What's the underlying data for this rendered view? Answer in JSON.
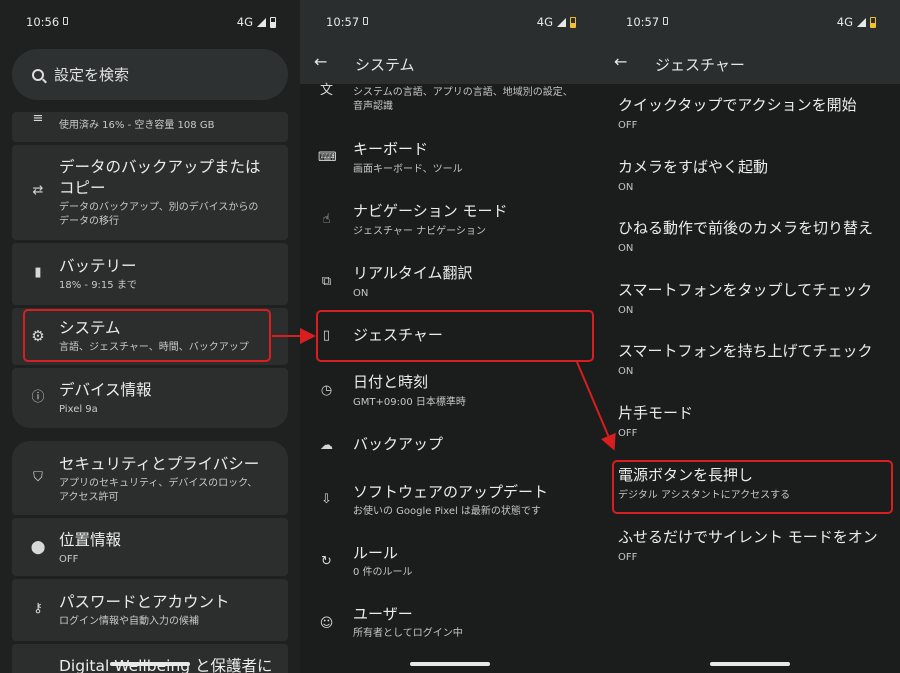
{
  "panel1": {
    "status": {
      "time": "10:56",
      "network": "4G"
    },
    "search_placeholder": "設定を検索",
    "storage_sub": "使用済み 16% - 空き容量 108 GB",
    "backup": {
      "title_l1": "データのバックアップまたは",
      "title_l2": "コピー",
      "sub_l1": "データのバックアップ、別のデバイスからの",
      "sub_l2": "データの移行"
    },
    "battery": {
      "title": "バッテリー",
      "sub": "18% - 9:15 まで"
    },
    "system": {
      "title": "システム",
      "sub": "言語、ジェスチャー、時間、バックアップ"
    },
    "device": {
      "title": "デバイス情報",
      "sub": "Pixel 9a"
    },
    "security": {
      "title": "セキュリティとプライバシー",
      "sub_l1": "アプリのセキュリティ、デバイスのロック、",
      "sub_l2": "アクセス許可"
    },
    "location": {
      "title": "位置情報",
      "sub": "OFF"
    },
    "password": {
      "title": "パスワードとアカウント",
      "sub": "ログイン情報や自動入力の候補"
    },
    "wellbeing": {
      "title": "Digital Wellbeing と保護者による"
    }
  },
  "panel2": {
    "status": {
      "time": "10:57",
      "network": "4G"
    },
    "title": "システム",
    "items": [
      {
        "sub_l1": "システムの言語、アプリの言語、地域別の設定、",
        "sub_l2": "音声認識"
      },
      {
        "title": "キーボード",
        "sub": "画面キーボード、ツール"
      },
      {
        "title": "ナビゲーション モード",
        "sub": "ジェスチャー ナビゲーション"
      },
      {
        "title": "リアルタイム翻訳",
        "sub": "ON"
      },
      {
        "title": "ジェスチャー"
      },
      {
        "title": "日付と時刻",
        "sub": "GMT+09:00 日本標準時"
      },
      {
        "title": "バックアップ"
      },
      {
        "title": "ソフトウェアのアップデート",
        "sub": "お使いの Google Pixel は最新の状態です"
      },
      {
        "title": "ルール",
        "sub": "0 件のルール"
      },
      {
        "title": "ユーザー",
        "sub": "所有者としてログイン中"
      }
    ]
  },
  "panel3": {
    "status": {
      "time": "10:57",
      "network": "4G"
    },
    "title": "ジェスチャー",
    "items": [
      {
        "title": "クイックタップでアクションを開始",
        "sub": "OFF"
      },
      {
        "title": "カメラをすばやく起動",
        "sub": "ON"
      },
      {
        "title": "ひねる動作で前後のカメラを切り替え",
        "sub": "ON"
      },
      {
        "title": "スマートフォンをタップしてチェック",
        "sub": "ON"
      },
      {
        "title": "スマートフォンを持ち上げてチェック",
        "sub": "ON"
      },
      {
        "title": "片手モード",
        "sub": "OFF"
      },
      {
        "title": "電源ボタンを長押し",
        "sub": "デジタル アシスタントにアクセスする"
      },
      {
        "title": "ふせるだけでサイレント モードをオン",
        "sub": "OFF"
      }
    ]
  },
  "colors": {
    "highlight": "#d81e1e",
    "card": "#2c2e2e",
    "background": "#1e1f1f"
  }
}
